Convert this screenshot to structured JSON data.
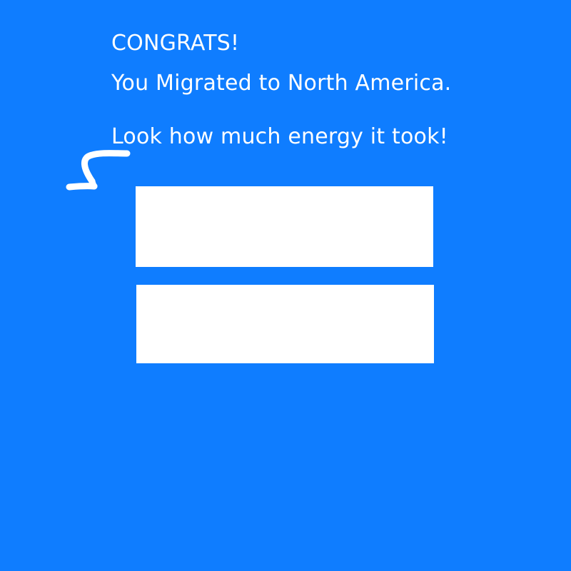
{
  "screen": {
    "background_color": "#0f7dff",
    "foreground_color": "#ffffff"
  },
  "message": {
    "line_1": "CONGRATS!",
    "line_2": "You Migrated to North America.",
    "line_3": "Look how much energy it took!"
  },
  "indicator": {
    "icon": "curved-arrow-down-left-icon"
  }
}
